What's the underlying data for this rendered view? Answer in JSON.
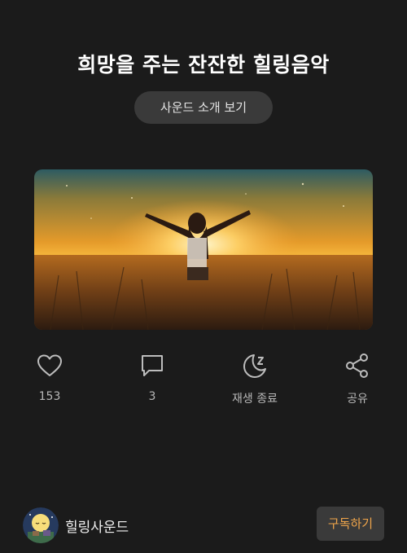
{
  "header": {
    "title": "희망을 주는 잔잔한 힐링음악",
    "intro_button": "사운드 소개 보기"
  },
  "cover": {
    "icon": "sunset-field-photo"
  },
  "actions": [
    {
      "icon": "heart-icon",
      "label": "153"
    },
    {
      "icon": "comment-icon",
      "label": "3"
    },
    {
      "icon": "sleep-timer-moon-icon",
      "label": "재생 종료"
    },
    {
      "icon": "share-icon",
      "label": "공유"
    }
  ],
  "channel": {
    "name": "힐링사운드",
    "subscribe_label": "구독하기"
  },
  "colors": {
    "background": "#1b1b1b",
    "button_bg": "#3a3a3a",
    "accent": "#f0a54a"
  }
}
